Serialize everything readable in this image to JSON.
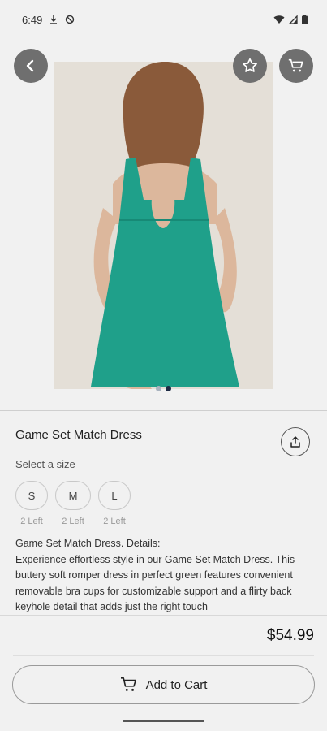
{
  "status_bar": {
    "time": "6:49",
    "icons": [
      "download-icon",
      "vpn-shield-icon",
      "wifi-icon",
      "signal-icon",
      "battery-icon"
    ]
  },
  "hero": {
    "image_description_icon": "product-photo",
    "buttons": {
      "back_icon": "back-arrow-icon",
      "favorite_icon": "star-icon",
      "cart_icon": "cart-icon"
    },
    "carousel": {
      "total": 2,
      "active": 2
    }
  },
  "product": {
    "title": "Game Set Match Dress",
    "size_label": "Select a size",
    "sizes": [
      {
        "label": "S",
        "stock": "2 Left"
      },
      {
        "label": "M",
        "stock": "2 Left"
      },
      {
        "label": "L",
        "stock": "2 Left"
      }
    ],
    "description_line1": "Game Set Match Dress. Details:",
    "description_body": "Experience effortless style in our Game Set Match Dress. This buttery soft romper dress in perfect green features convenient removable bra cups for customizable support and a flirty back keyhole detail that adds just the right touch",
    "price": "$54.99"
  },
  "footer": {
    "add_to_cart_label": "Add to Cart"
  },
  "colors": {
    "background": "#f1f1f1",
    "dress": "#1fa08a",
    "photo_bg": "#e3dfd8",
    "icon_button": "#6f6f6f"
  }
}
